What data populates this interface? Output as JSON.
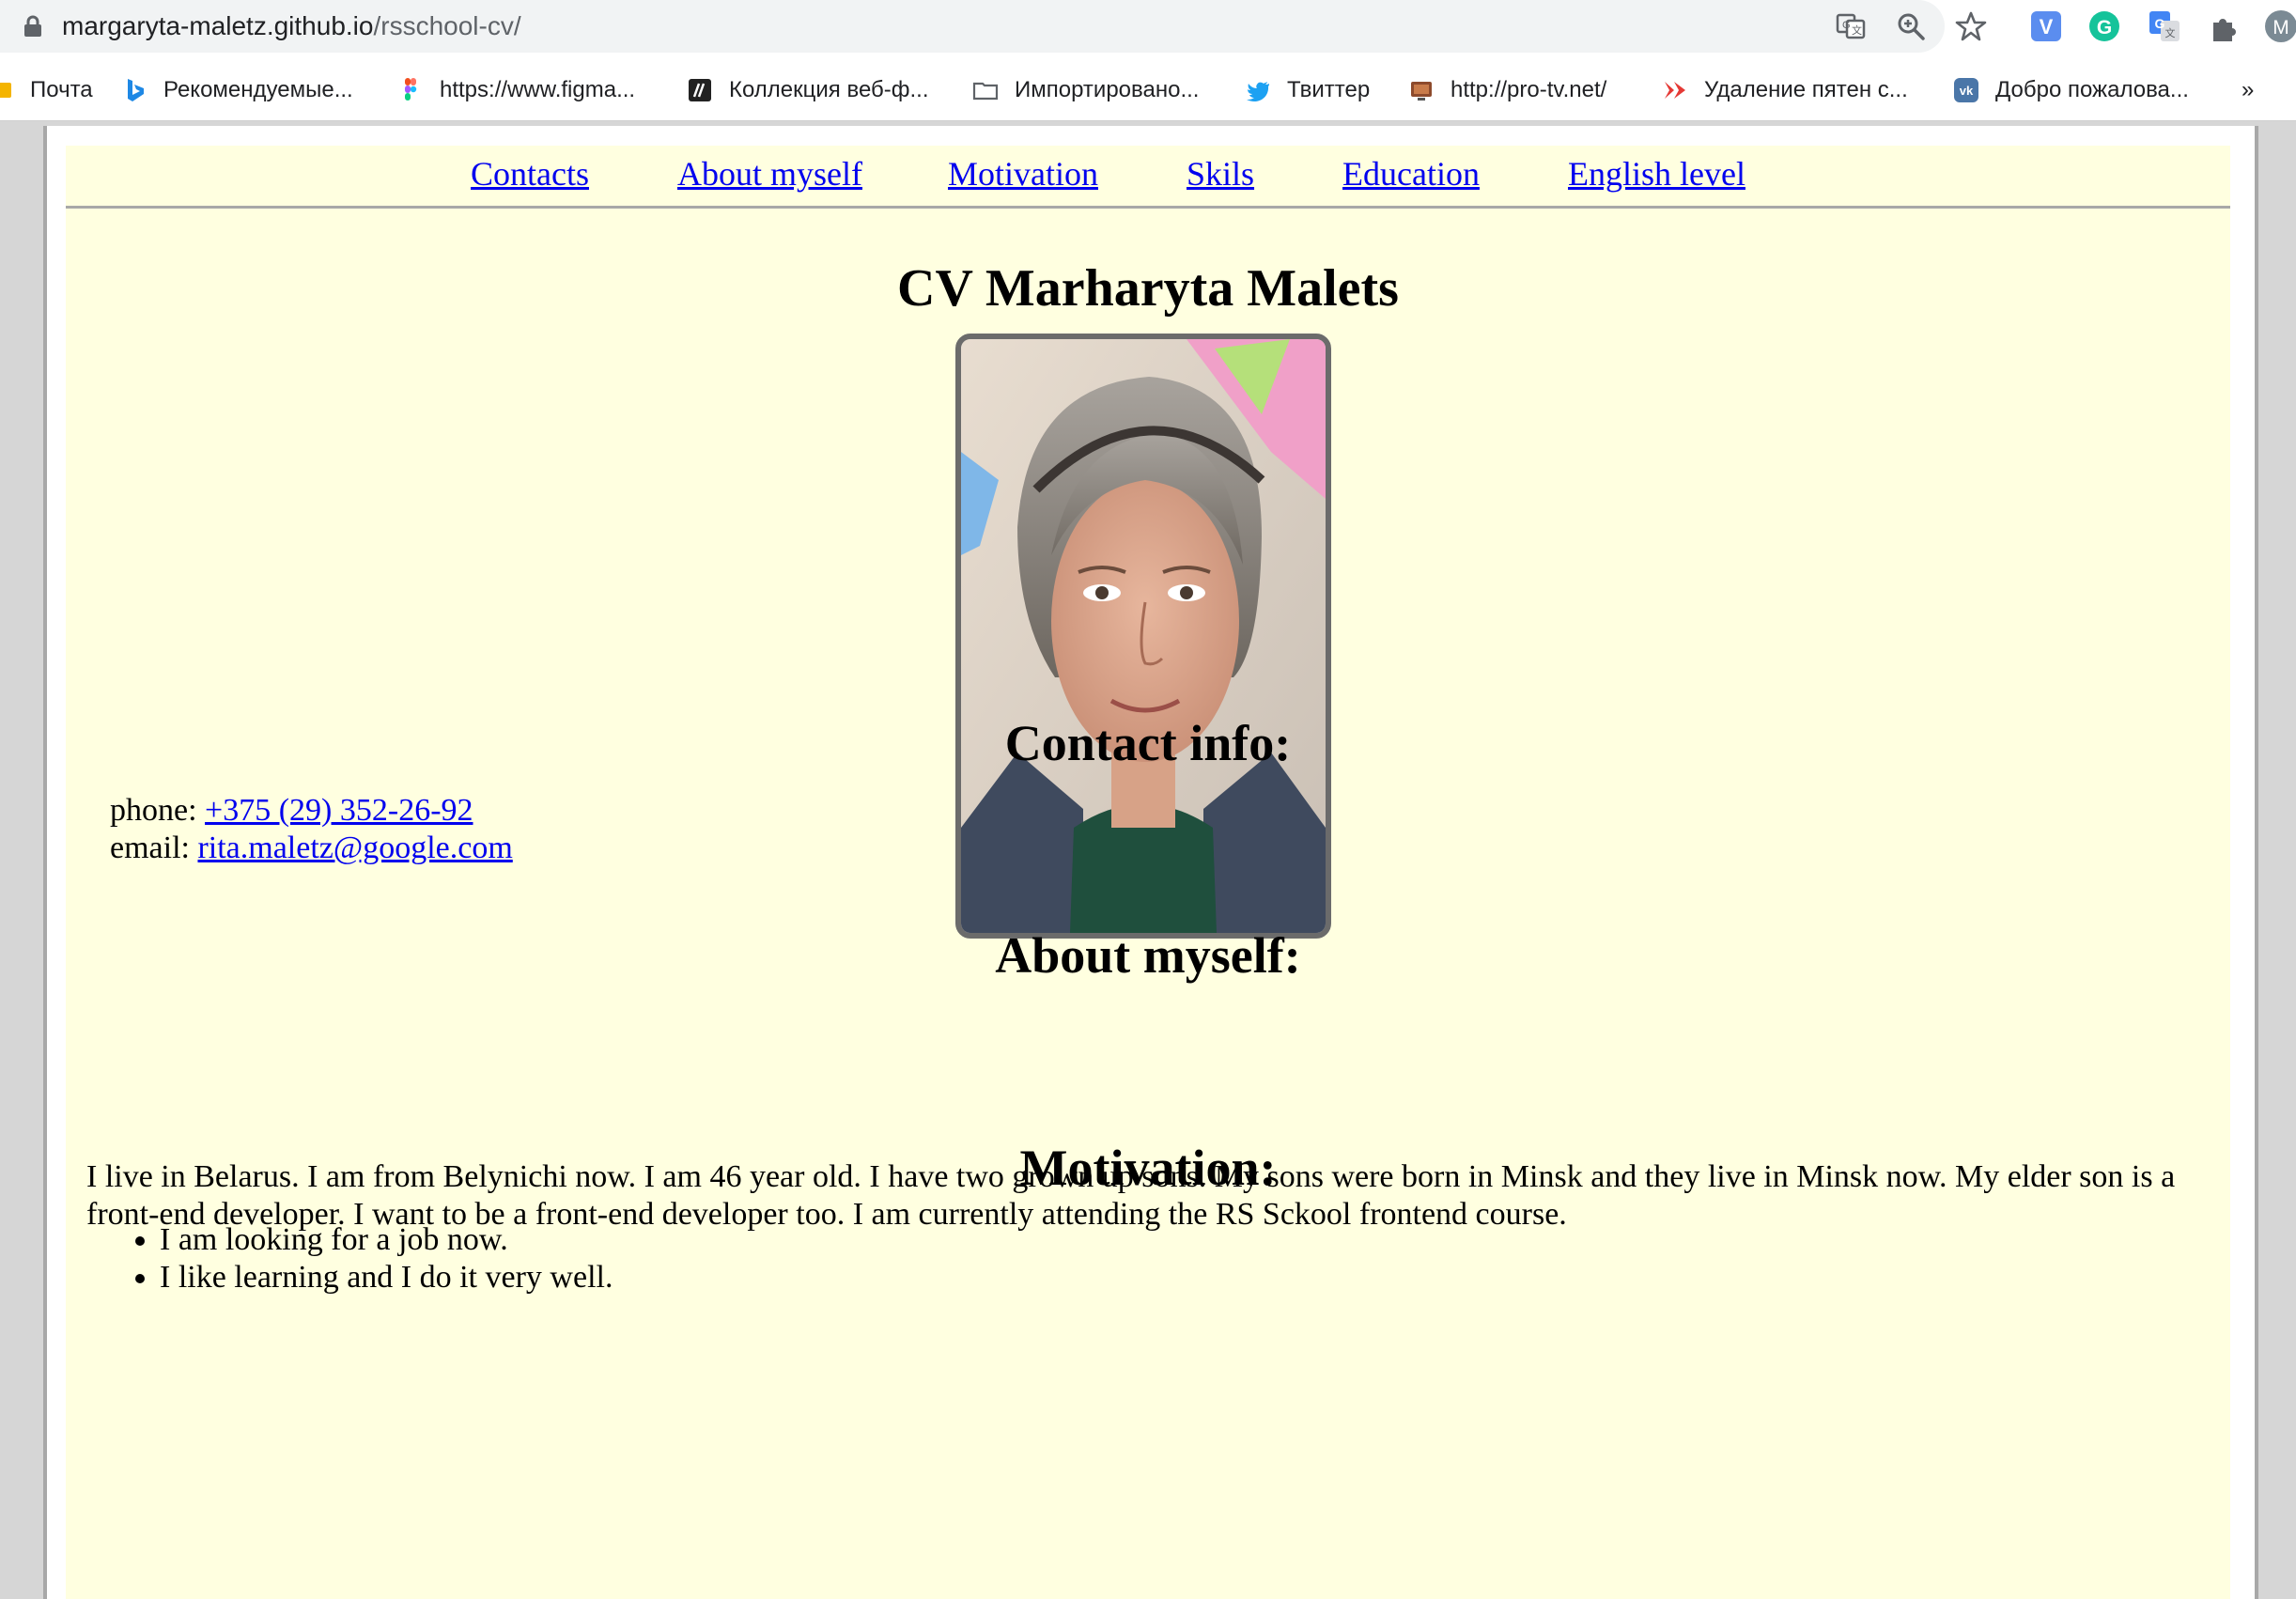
{
  "browser": {
    "url_host": "margaryta-maletz.github.io",
    "url_path": "/rsschool-cv/",
    "extension_v_letter": "V",
    "extension_g_letter": "G",
    "profile_letter": "M",
    "bookmarks": [
      {
        "label": "Почта",
        "icon": "mail-bookmark-icon"
      },
      {
        "label": "Рекомендуемые...",
        "icon": "bing-icon"
      },
      {
        "label": "https://www.figma...",
        "icon": "figma-icon"
      },
      {
        "label": "Коллекция веб-ф...",
        "icon": "webflow-icon"
      },
      {
        "label": "Импортировано...",
        "icon": "folder-icon"
      },
      {
        "label": "Твиттер",
        "icon": "twitter-icon"
      },
      {
        "label": "http://pro-tv.net/",
        "icon": "tv-icon"
      },
      {
        "label": "Удаление пятен с...",
        "icon": "arrow-red-icon"
      },
      {
        "label": "Добро пожалова...",
        "icon": "vk-icon"
      }
    ],
    "overflow_label": "»"
  },
  "nav": {
    "items": [
      "Contacts",
      "About myself",
      "Motivation",
      "Skils",
      "Education",
      "English level"
    ]
  },
  "title": "CV Marharyta Malets",
  "contact": {
    "heading": "Contact info:",
    "phone_label": "phone:",
    "phone": "+375 (29) 352-26-92",
    "email_label": "email:",
    "email": "rita.maletz@google.com"
  },
  "about": {
    "heading": "About myself:",
    "text": "I live in Belarus. I am from Belynichi now. I am 46 year old. I have two grown up sons. My sons were born in Minsk and they live in Minsk now. My elder son is a front-end developer. I want to be a front-end developer too. I am currently attending the RS Sckool frontend course."
  },
  "motivation": {
    "heading": "Motivation:",
    "items": [
      "I am looking for a job now.",
      "I like learning and I do it very well."
    ]
  },
  "colors": {
    "page_background": "#ffffe0",
    "link": "#0000ee"
  }
}
